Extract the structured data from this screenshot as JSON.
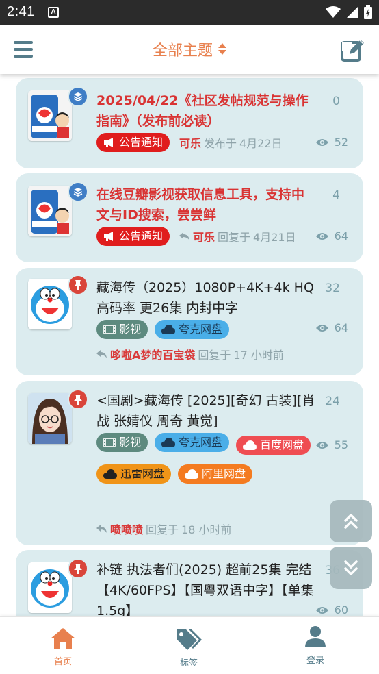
{
  "status_bar": {
    "time": "2:41",
    "notification_letter": "A"
  },
  "header": {
    "title": "全部主题"
  },
  "colors": {
    "accent": "#e8804e",
    "nav_active": "#e8804e",
    "card_bg": "#dcecef",
    "notice_red": "#e01d1d"
  },
  "topics": [
    {
      "title": "2025/04/22《社区发帖规范与操作指南》（发布前必读）",
      "title_style": "announcement",
      "badge_icon": "layers-icon",
      "avatar": "cola-can-crayon-shin-chan",
      "count": "0",
      "views": "52",
      "tags": [
        {
          "label": "公告通知",
          "icon": "megaphone-icon",
          "kind": "notice"
        }
      ],
      "author": "可乐",
      "action": "发布于",
      "time": "4月22日",
      "reply_icon": false
    },
    {
      "title": "在线豆瓣影视获取信息工具，支持中文与ID搜索，尝尝鲜",
      "title_style": "announcement",
      "badge_icon": "layers-icon",
      "avatar": "cola-can-crayon-shin-chan",
      "count": "4",
      "views": "64",
      "tags": [
        {
          "label": "公告通知",
          "icon": "megaphone-icon",
          "kind": "notice"
        }
      ],
      "author": "可乐",
      "action": "回复于",
      "time": "4月21日",
      "reply_icon": true
    },
    {
      "title": "藏海传（2025）1080P+4K+4k HQ 高码率 更26集 内封中字",
      "title_style": "normal",
      "badge_icon": "pin-icon",
      "avatar": "doraemon",
      "count": "32",
      "views": "64",
      "tags": [
        {
          "label": "影视",
          "icon": "film-icon",
          "kind": "video"
        },
        {
          "label": "夸克网盘",
          "icon": "cloud-icon",
          "kind": "quark"
        }
      ],
      "author": "哆啦A梦的百宝袋",
      "action": "回复于",
      "time": "17 小时前",
      "reply_icon": true
    },
    {
      "title": "<国剧>藏海传 [2025][奇幻 古装][肖战 张婧仪 周奇 黄觉]",
      "title_style": "normal",
      "badge_icon": "pin-icon",
      "avatar": "girl-with-glasses",
      "count": "24",
      "views": "55",
      "tags": [
        {
          "label": "影视",
          "icon": "film-icon",
          "kind": "video"
        },
        {
          "label": "夸克网盘",
          "icon": "cloud-icon",
          "kind": "quark"
        },
        {
          "label": "百度网盘",
          "icon": "cloud-icon",
          "kind": "baidu"
        },
        {
          "label": "迅雷网盘",
          "icon": "cloud-icon",
          "kind": "xunlei"
        },
        {
          "label": "阿里网盘",
          "icon": "cloud-icon",
          "kind": "aliyun"
        }
      ],
      "author": "喷喷喷",
      "action": "回复于",
      "time": "18 小时前",
      "reply_icon": true
    },
    {
      "title": "补链 执法者们(2025) 超前25集 完结【4K/60FPS】【国粤双语中字】【单集1.5g】",
      "title_style": "normal",
      "badge_icon": "pin-icon",
      "avatar": "doraemon",
      "count": "36",
      "views": "60",
      "tags": [],
      "author": "",
      "action": "",
      "time": "",
      "reply_icon": false
    }
  ],
  "float_buttons": [
    {
      "icon": "double-chevron-up-icon"
    },
    {
      "icon": "double-chevron-down-icon"
    }
  ],
  "bottom_nav": [
    {
      "label": "首页",
      "icon": "home-icon",
      "active": true
    },
    {
      "label": "标签",
      "icon": "tags-icon",
      "active": false
    },
    {
      "label": "登录",
      "icon": "user-icon",
      "active": false
    }
  ]
}
